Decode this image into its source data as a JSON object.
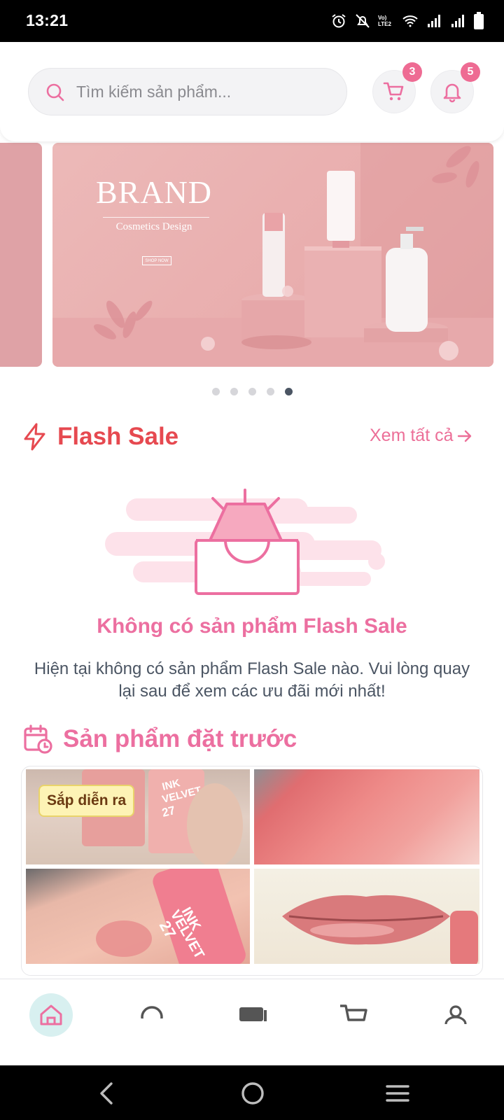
{
  "status_bar": {
    "time": "13:21",
    "network_label": "Vo) LTE2"
  },
  "header": {
    "search": {
      "placeholder": "Tìm kiếm sản phẩm..."
    },
    "cart_badge": "3",
    "notification_badge": "5"
  },
  "banner": {
    "brand": "BRAND",
    "subtitle": "Cosmetics Design",
    "cta": "SHOP NOW",
    "pages": 5,
    "active_page": 5
  },
  "flash_sale": {
    "title": "Flash Sale",
    "see_all": "Xem tất cả",
    "empty_title": "Không có sản phẩm Flash Sale",
    "empty_desc": "Hiện tại không có sản phẩm Flash Sale nào. Vui lòng quay lại sau để xem các ưu đãi mới nhất!"
  },
  "preorder": {
    "title": "Sản phẩm đặt trước",
    "badge": "Sắp diễn ra",
    "product_text": "INK VELVET 27"
  },
  "colors": {
    "accent_pink": "#ec6fa0",
    "flash_red": "#e64950",
    "nav_active_bg": "#d8f0f0"
  },
  "bottom_nav": {
    "items": [
      "home-icon",
      "search-icon",
      "video-icon",
      "cart-icon",
      "profile-icon"
    ],
    "active": "home-icon"
  }
}
